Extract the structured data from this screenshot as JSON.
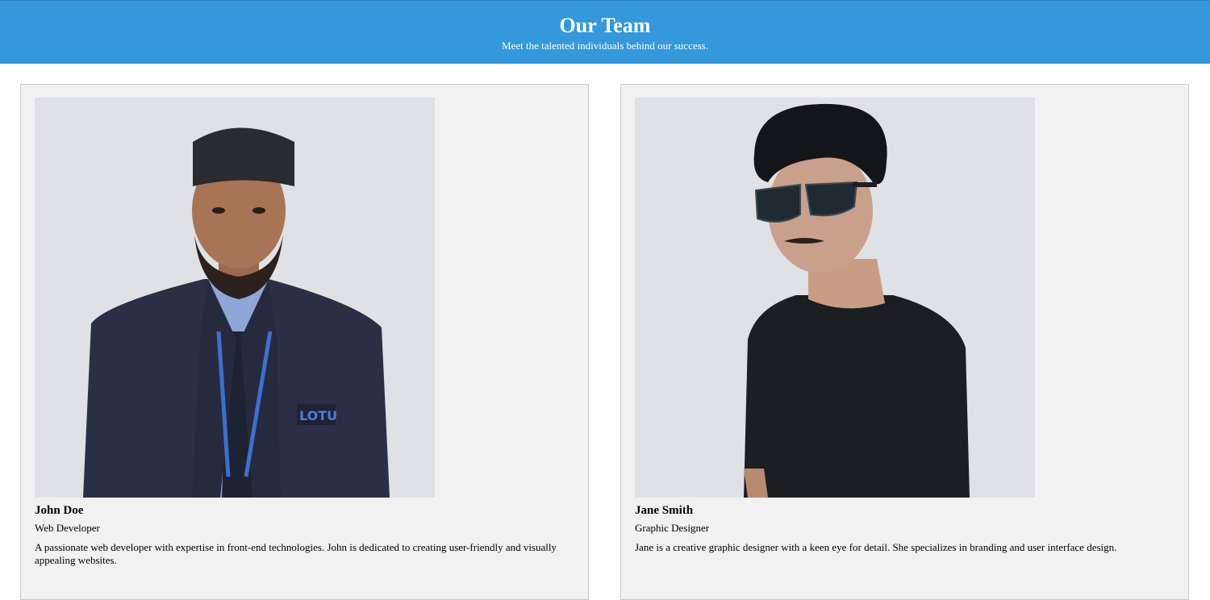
{
  "header": {
    "title": "Our Team",
    "subtitle": "Meet the talented individuals behind our success.",
    "background_color": "#3498db"
  },
  "members": [
    {
      "name": "John Doe",
      "role": "Web Developer",
      "bio": "A passionate web developer with expertise in front-end technologies. John is dedicated to creating user-friendly and visually appealing websites.",
      "photo_badge_text": "LOTU"
    },
    {
      "name": "Jane Smith",
      "role": "Graphic Designer",
      "bio": "Jane is a creative graphic designer with a keen eye for detail. She specializes in branding and user interface design."
    }
  ]
}
